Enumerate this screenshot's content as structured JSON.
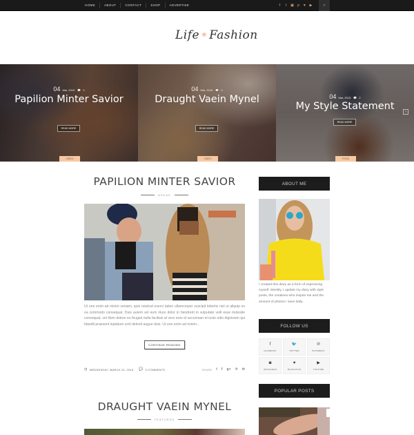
{
  "topbar": {
    "nav": [
      "HOME",
      "ABOUT",
      "CONTACT",
      "SHOP",
      "ADVERTISE"
    ],
    "social_icons": [
      "facebook-icon",
      "twitter-icon",
      "instagram-icon",
      "pinterest-icon",
      "bloglovin-icon",
      "youtube-icon"
    ],
    "search_icon": "search-icon"
  },
  "header": {
    "logo_left": "Life",
    "logo_right": "Fashion",
    "logo_mark": "❀"
  },
  "slider": [
    {
      "day": "04",
      "month_year": "Mar, 2015",
      "comments": "0",
      "title": "Papilion Minter Savior",
      "read_more": "READ MORE",
      "category": "VIDEO"
    },
    {
      "day": "04",
      "month_year": "Mar, 2015",
      "comments": "0",
      "title": "Draught Vaein Mynel",
      "read_more": "READ MORE",
      "category": "VIDEO"
    },
    {
      "day": "04",
      "month_year": "Mar, 2015",
      "comments": "2",
      "title": "My Style Statement",
      "read_more": "READ MORE",
      "category": "FOOD"
    }
  ],
  "posts": [
    {
      "title": "PAPILION MINTER SAVIOR",
      "category": "BREAK",
      "excerpt": "Ut one enim ad minim veniam, quis nostrud exerci tation ullamcorper suscipit lobortis nisl ut aliquip ex ea commodo consequat. Duis autem vel eum iriure dolor in hendrerit in vulputate velit esse molestie consequat, vel illum dolore eu feugiat nulla facilisis at vero eros et accumsan et iusto odio dignissim qui blandit praesent luptatum zzril delenit augue duis. Ut one enim ad minim...",
      "continue_label": "CONTINUE READING",
      "date": "WEDNESDAY, MARCH 24, 2016",
      "comments": "0 COMMENTS",
      "share_label": "SHARE"
    },
    {
      "title": "DRAUGHT VAEIN MYNEL",
      "category": "FEATURED"
    }
  ],
  "sidebar": {
    "about_title": "ABOUT ME",
    "about_text": "I created this diary as a form of expressing myself. Weekly, I update my diary with style posts, the creatives who inspire me and the amount of photos I save daily.",
    "follow_title": "FOLLOW US",
    "follow_items": [
      {
        "icon": "f",
        "label": "FACEBOOK"
      },
      {
        "icon": "🐦",
        "label": "TWITTER"
      },
      {
        "icon": "℗",
        "label": "PINTEREST"
      },
      {
        "icon": "◙",
        "label": "INSTAGRAM"
      },
      {
        "icon": "♥",
        "label": "BLOGLOVIN"
      },
      {
        "icon": "▶",
        "label": "YOUTUBE"
      }
    ],
    "popular_title": "POPULAR POSTS"
  },
  "colors": {
    "accent": "#f6c9a3",
    "topbar": "#1a1a1a",
    "widget_title_bg": "#1c1c1c"
  }
}
